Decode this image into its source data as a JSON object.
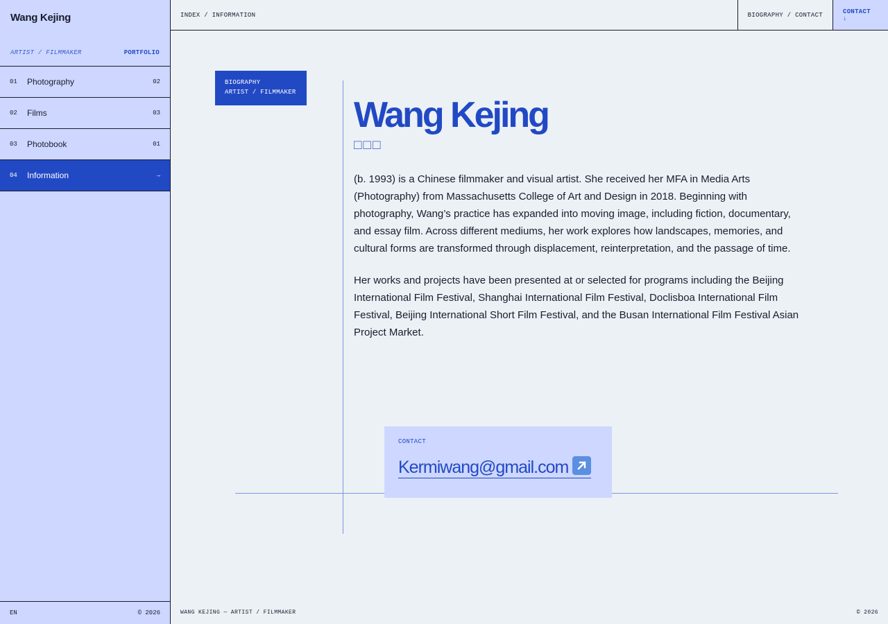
{
  "sidebar": {
    "brand": "Wang Kejing",
    "role": "ARTIST / FILMMAKER",
    "portfolio_label": "PORTFOLIO",
    "items": [
      {
        "num": "01",
        "label": "Photography",
        "count": "02"
      },
      {
        "num": "02",
        "label": "Films",
        "count": "03"
      },
      {
        "num": "03",
        "label": "Photobook",
        "count": "01"
      },
      {
        "num": "04",
        "label": "Information",
        "count": "→"
      }
    ],
    "footer": {
      "lang": "EN",
      "copyright": "© 2026"
    }
  },
  "topbar": {
    "breadcrumb": "INDEX / INFORMATION",
    "bio_contact": "BIOGRAPHY / CONTACT",
    "contact": "CONTACT ↓"
  },
  "main": {
    "tag_line1": "BIOGRAPHY",
    "tag_line2": "ARTIST / FILMMAKER",
    "name": "Wang Kejing",
    "name_cjk": "□□□",
    "para1": "(b. 1993) is a Chinese filmmaker and visual artist. She received her MFA in Media Arts (Photography) from Massachusetts College of Art and Design in 2018. Beginning with photography, Wang’s practice has expanded into moving image, including fiction, documentary, and essay film. Across different mediums, her work explores how landscapes, memories, and cultural forms are transformed through displacement, reinterpretation, and the passage of time.",
    "para2": "Her works and projects have been presented at or selected for programs including the Beijing International Film Festival, Shanghai International Film Festival, Doclisboa International Film Festival, Beijing International Short Film Festival, and the Busan International Film Festival Asian Project Market.",
    "contact_label": "CONTACT",
    "contact_email": "Kermiwang@gmail.com"
  },
  "bottombar": {
    "left": "WANG KEJING — ARTIST / FILMMAKER",
    "right": "© 2026"
  },
  "colors": {
    "accent": "#2249C4",
    "sidebar_bg": "#CDD7FF",
    "page_bg": "#ECF1F5"
  }
}
